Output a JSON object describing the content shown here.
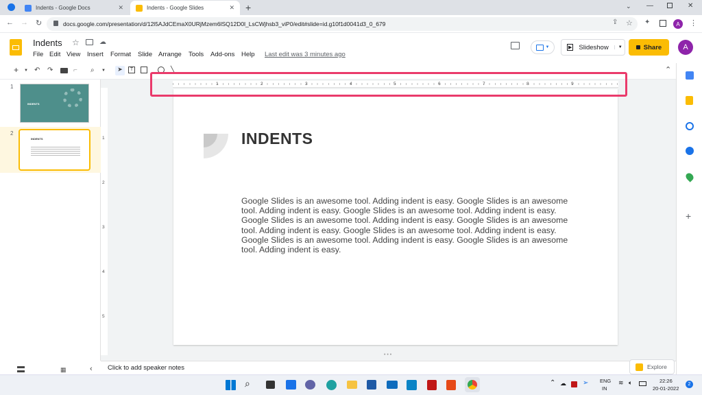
{
  "browser": {
    "tabs": [
      {
        "title": "Indents - Google Docs",
        "active": false,
        "color": "#4285f4"
      },
      {
        "title": "Indents - Google Slides",
        "active": true,
        "color": "#fbbc04"
      }
    ],
    "new_tab_label": "+",
    "url": "docs.google.com/presentation/d/12l5AJdCEmaX0URjMzem6lSQ12D0l_LsCWjhsb3_viP0/edit#slide=id.g10f1d0041d3_0_679",
    "avatar_letter": "A"
  },
  "app": {
    "doc_title": "Indents",
    "menu": [
      "File",
      "Edit",
      "View",
      "Insert",
      "Format",
      "Slide",
      "Arrange",
      "Tools",
      "Add-ons",
      "Help"
    ],
    "last_edit": "Last edit was 3 minutes ago",
    "slideshow_label": "Slideshow",
    "share_label": "Share",
    "avatar_letter": "A"
  },
  "filmstrip": {
    "slides": [
      {
        "number": "1",
        "title": "INDENTS",
        "selected": false
      },
      {
        "number": "2",
        "title": "INDENTS",
        "selected": true
      }
    ]
  },
  "ruler": {
    "horizontal_labels": [
      "1",
      "2",
      "3",
      "4",
      "5",
      "6",
      "7",
      "8",
      "9"
    ],
    "vertical_labels": [
      "1",
      "2",
      "3",
      "4",
      "5"
    ]
  },
  "slide": {
    "title": "INDENTS",
    "body": "Google Slides is an awesome tool. Adding indent is easy. Google Slides is an awesome tool. Adding indent is easy. Google Slides is an awesome tool. Adding indent is easy. Google Slides is an awesome tool. Adding indent is easy. Google Slides is an awesome tool. Adding indent is easy. Google Slides is an awesome tool. Adding indent is easy. Google Slides is an awesome tool. Adding indent is easy. Google Slides is an awesome tool. Adding indent is easy."
  },
  "notes": {
    "placeholder": "Click to add speaker notes"
  },
  "explore_label": "Explore",
  "taskbar": {
    "language": "ENG",
    "region": "IN",
    "time": "22:26",
    "date": "20-01-2022",
    "notification_count": "2"
  },
  "colors": {
    "highlight": "#ea3a6b",
    "share": "#fbbc04",
    "slide_teal": "#4e8f8b"
  }
}
